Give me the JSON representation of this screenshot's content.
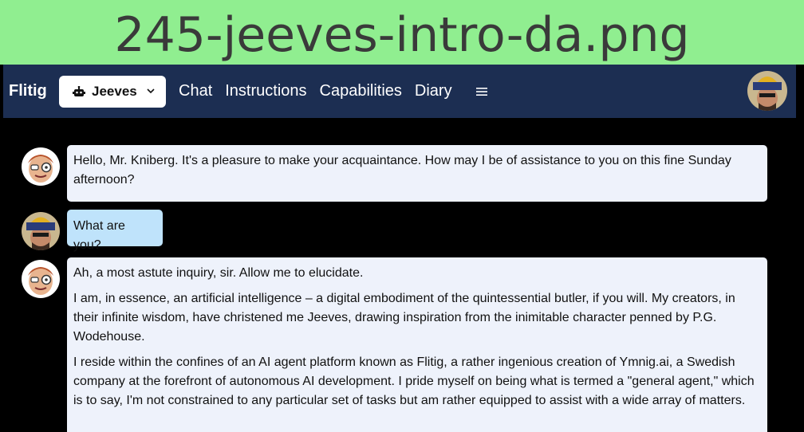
{
  "banner": {
    "filename": "245-jeeves-intro-da.png"
  },
  "navbar": {
    "brand": "Flitig",
    "agent_select": {
      "selected": "Jeeves"
    },
    "links": [
      "Chat",
      "Instructions",
      "Capabilities",
      "Diary"
    ],
    "menu_icon": "hamburger-icon"
  },
  "chat": {
    "messages": [
      {
        "sender": "agent",
        "paragraphs": [
          "Hello, Mr. Kniberg. It's a pleasure to make your acquaintance. How may I be of assistance to you on this fine Sunday afternoon?"
        ]
      },
      {
        "sender": "user",
        "paragraphs": [
          "What are you?"
        ]
      },
      {
        "sender": "agent",
        "paragraphs": [
          "Ah, a most astute inquiry, sir. Allow me to elucidate.",
          "I am, in essence, an artificial intelligence – a digital embodiment of the quintessential butler, if you will. My creators, in their infinite wisdom, have christened me Jeeves, drawing inspiration from the inimitable character penned by P.G. Wodehouse.",
          "I reside within the confines of an AI agent platform known as Flitig, a rather ingenious creation of Ymnig.ai, a Swedish company at the forefront of autonomous AI development. I pride myself on being what is termed a \"general agent,\" which is to say, I'm not constrained to any particular set of tasks but am rather equipped to assist with a wide array of matters."
        ]
      }
    ]
  },
  "colors": {
    "banner_bg": "#90EE90",
    "navbar_bg": "#1c2e52",
    "agent_bubble": "#eef2fb",
    "user_bubble": "#bfe3fb",
    "chat_bg": "#000000"
  }
}
